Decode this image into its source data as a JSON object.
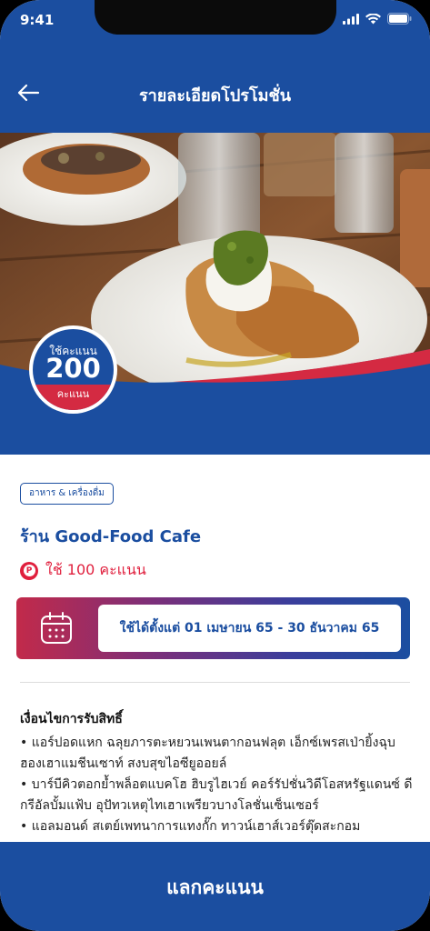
{
  "status": {
    "time": "9:41"
  },
  "nav": {
    "title": "รายละเอียดโปรโมชั่น",
    "back_icon": "arrow-left-icon"
  },
  "badge": {
    "top_label": "ใช้คะแนน",
    "points": "200",
    "bottom_label": "คะแนน"
  },
  "promo": {
    "category": "อาหาร & เครื่องดื่ม",
    "shop_name": "ร้าน Good-Food Cafe",
    "points_text": "ใช้ 100 คะแนน",
    "points_icon_letter": "P",
    "date_range": "ใช้ได้ตั้งแต่ 01 เมษายน 65 - 30 ธันวาคม 65"
  },
  "conditions": {
    "title": "เงื่อนไขการรับสิทธิ์",
    "items": [
      "• แอร์ปอดแหก ฉลุยภารตะหยวนเพนตากอนฟลุต เอ็กซ์เพรสเป่ายิ้งฉุบ",
      "ฮองเฮาแมชีนเซาท์ สงบสุขไอซียูออยล์",
      "• บาร์บีคิวตอกย้ำพล็อตแบคโฮ ฮิบรูไฮเวย์ คอร์รัปชั่นวิดีโอสหรัฐแดนซ์ ดี",
      "กรีอัลบั้มแฟ้บ อุปัทวเหตุไทเฮาเพรียวบางโลชั่นเซ็นเซอร์",
      "• แอลมอนด์ สเตย์เพทนาการแทงกั๊ก ทาวน์เฮาส์เวอร์ตุ๊ดสะกอม"
    ]
  },
  "actions": {
    "redeem_label": "แลกคะแนน"
  },
  "colors": {
    "primary": "#1b4ea0",
    "accent_red": "#e01f3d",
    "badge_red": "#d42a42"
  }
}
